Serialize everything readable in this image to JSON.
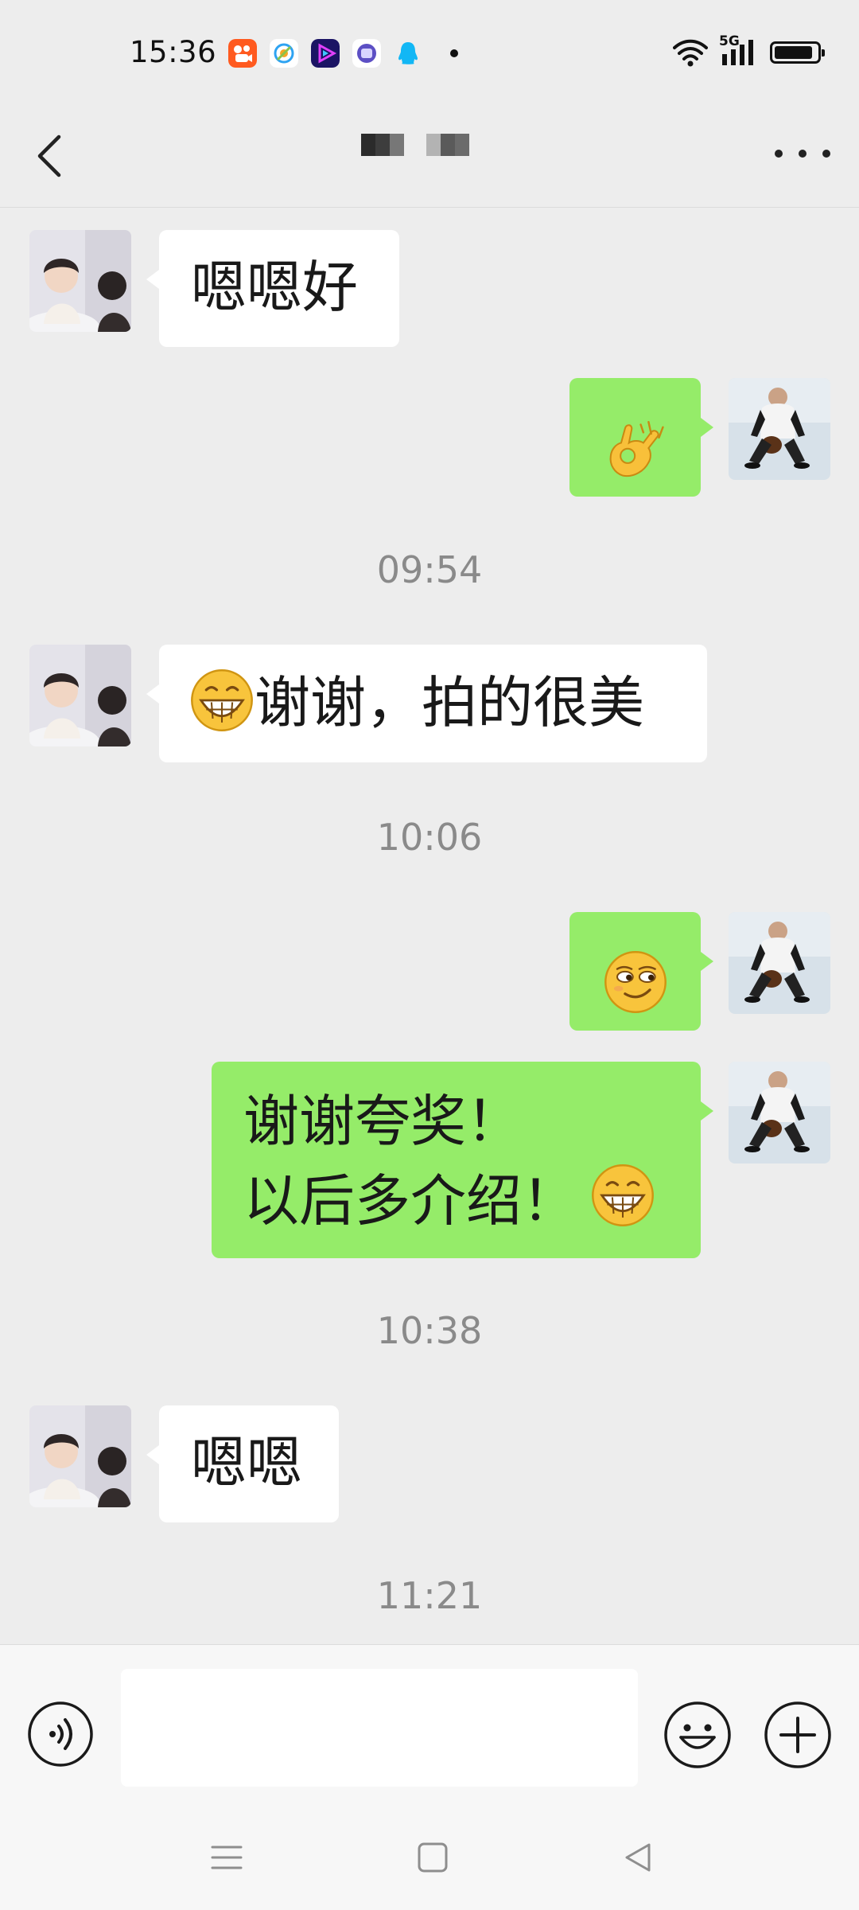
{
  "status_bar": {
    "time": "15:36",
    "network": "5G",
    "battery_percent": 90,
    "app_icons": [
      "kuaishou-icon",
      "browser-icon",
      "video-player-icon",
      "app-icon",
      "qq-icon"
    ]
  },
  "header": {
    "title": "",
    "back_icon": "chevron-left-icon",
    "more_icon": "more-dots-icon"
  },
  "messages": [
    {
      "side": "in",
      "text": "嗯嗯好"
    },
    {
      "side": "out",
      "emoji": "ok-hand-emoji"
    },
    {
      "time": "09:54"
    },
    {
      "side": "in",
      "emoji": "grin-emoji",
      "text": "谢谢，拍的很美"
    },
    {
      "time": "10:06"
    },
    {
      "side": "out",
      "emoji": "smirk-emoji"
    },
    {
      "side": "out",
      "lines": [
        "谢谢夸奖！",
        "以后多介绍！"
      ],
      "emoji": "grin-emoji"
    },
    {
      "time": "10:38"
    },
    {
      "side": "in",
      "text": "嗯嗯"
    },
    {
      "time": "11:21"
    }
  ],
  "m1_text": "嗯嗯好",
  "ts1": "09:54",
  "m3_text": "谢谢，拍的很美",
  "ts2": "10:06",
  "m5_line1": "谢谢夸奖！",
  "m5_line2": "以后多介绍！",
  "ts3": "10:38",
  "m6_text": "嗯嗯",
  "ts4": "11:21",
  "input": {
    "value": "",
    "placeholder": ""
  },
  "colors": {
    "background": "#ededed",
    "outgoing_bubble": "#95ec69",
    "incoming_bubble": "#ffffff",
    "timestamp": "#8a8a8a"
  }
}
